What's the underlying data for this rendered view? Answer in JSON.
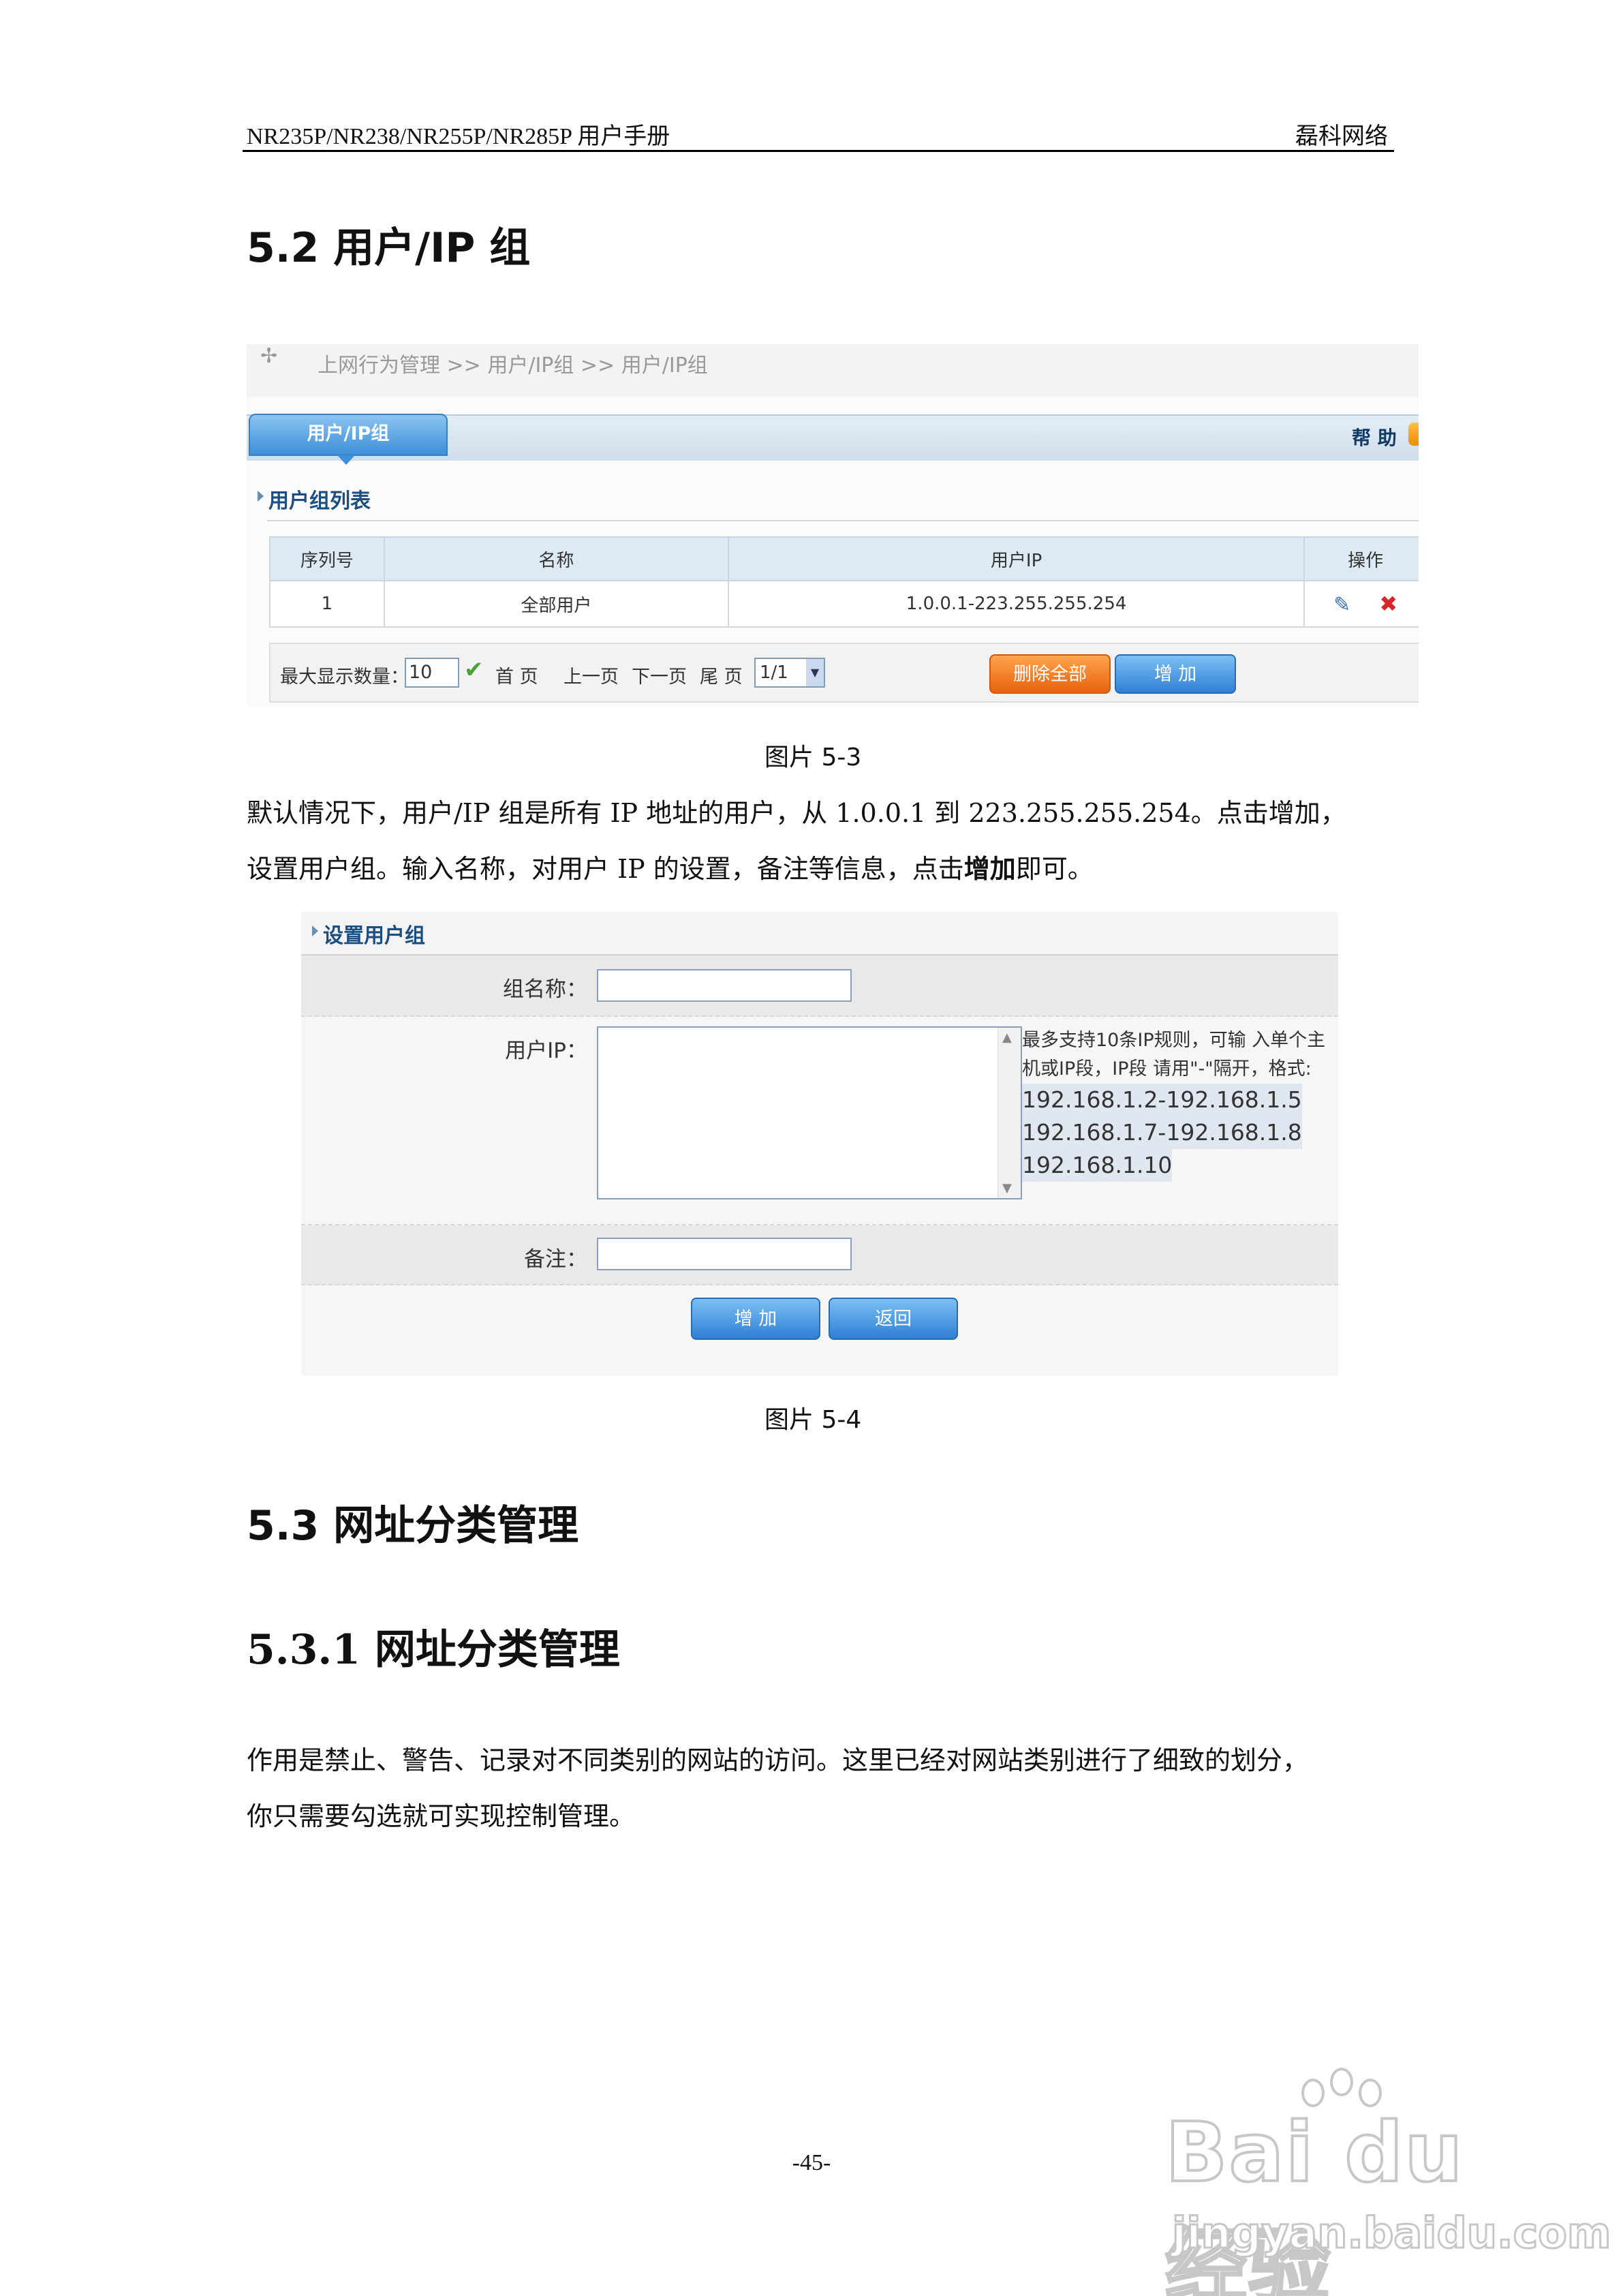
{
  "header": {
    "left": "NR235P/NR238/NR255P/NR285P 用户手册",
    "right": "磊科网络"
  },
  "section_52": {
    "title": "5.2 用户/IP 组"
  },
  "figure1": {
    "breadcrumb": "上网行为管理 >> 用户/IP组 >> 用户/IP组",
    "tab": "用户/IP组",
    "help": "帮 助",
    "list_title": "用户组列表",
    "columns": [
      "序列号",
      "名称",
      "用户IP",
      "操作"
    ],
    "rows": [
      {
        "index": "1",
        "name": "全部用户",
        "ip": "1.0.0.1-223.255.255.254"
      }
    ],
    "pager": {
      "max_label": "最大显示数量：",
      "max_value": "10",
      "first": "首 页",
      "prev": "上一页",
      "next": "下一页",
      "last": "尾 页",
      "page": "1/1"
    },
    "delete_all": "删除全部",
    "add": "增 加",
    "caption": "图片  5-3"
  },
  "paragraph1": {
    "line1": "默认情况下，用户/IP 组是所有 IP 地址的用户，从 1.0.0.1 到 223.255.255.254。点击增加，",
    "line2_pre": "设置用户组。输入名称，对用户 IP 的设置，备注等信息，点击",
    "line2_bold": "增加",
    "line2_post": "即可。"
  },
  "figure2": {
    "title": "设置用户组",
    "group_name_label": "组名称：",
    "user_ip_label": "用户IP：",
    "hint_text": "最多支持10条IP规则，可输 入单个主 机或IP段，IP段 请用\"-\"隔开，格式:",
    "hint_examples": [
      "192.168.1.2-192.168.1.5",
      "192.168.1.7-192.168.1.8",
      "192.168.1.10"
    ],
    "remark_label": "备注：",
    "add": "增 加",
    "back": "返回",
    "caption": "图片  5-4"
  },
  "section_53": {
    "title": "5.3 网址分类管理"
  },
  "section_531": {
    "title": "5.3.1 网址分类管理"
  },
  "paragraph2": {
    "line1": "作用是禁止、警告、记录对不同类别的网站的访问。这里已经对网站类别进行了细致的划分，",
    "line2": "你只需要勾选就可实现控制管理。"
  },
  "footer": {
    "page": "-45-"
  },
  "watermark": {
    "main": "Bai du 经验",
    "sub": "jingyan.baidu.com"
  }
}
